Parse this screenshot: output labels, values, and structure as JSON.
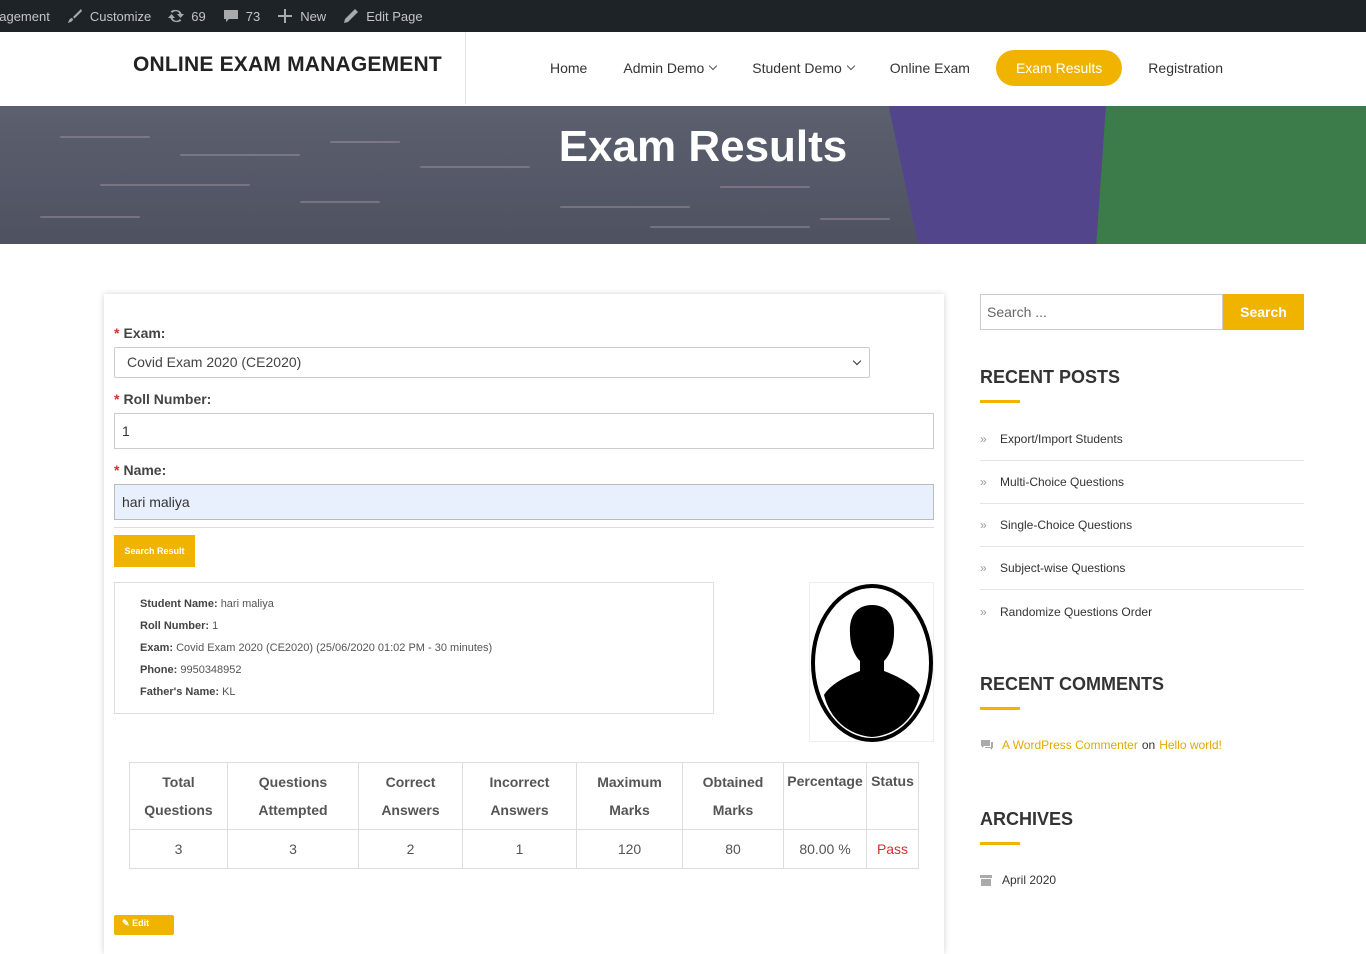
{
  "admin_bar": {
    "site_name": "nagement",
    "customize": "Customize",
    "updates_count": "69",
    "comments_count": "73",
    "new": "New",
    "edit_page": "Edit Page"
  },
  "header": {
    "site_title": "ONLINE EXAM MANAGEMENT",
    "nav": [
      {
        "label": "Home"
      },
      {
        "label": "Admin Demo"
      },
      {
        "label": "Student Demo"
      },
      {
        "label": "Online Exam"
      },
      {
        "label": "Exam Results"
      },
      {
        "label": "Registration"
      }
    ]
  },
  "banner": {
    "title": "Exam Results"
  },
  "form": {
    "exam_label": "Exam:",
    "exam_value": "Covid Exam 2020 (CE2020)",
    "roll_label": "Roll Number:",
    "roll_value": "1",
    "name_label": "Name:",
    "name_value": "hari maliya",
    "required_mark": "*",
    "search_button": "Search Result"
  },
  "student_info": {
    "student_name_label": "Student Name:",
    "student_name": "hari maliya",
    "roll_label": "Roll Number:",
    "roll": "1",
    "exam_label": "Exam:",
    "exam": "Covid Exam 2020 (CE2020) (25/06/2020 01:02 PM - 30 minutes)",
    "phone_label": "Phone:",
    "phone": "9950348952",
    "father_label": "Father's Name:",
    "father": "KL"
  },
  "results_table": {
    "headers": [
      [
        "Total",
        "Questions"
      ],
      [
        "Questions",
        "Attempted"
      ],
      [
        "Correct",
        "Answers"
      ],
      [
        "Incorrect",
        "Answers"
      ],
      [
        "Maximum",
        "Marks"
      ],
      [
        "Obtained",
        "Marks"
      ],
      [
        "Percentage",
        ""
      ],
      [
        "Status",
        ""
      ]
    ],
    "row": [
      "3",
      "3",
      "2",
      "1",
      "120",
      "80",
      "80.00 %",
      "Pass"
    ]
  },
  "edit_button": "Edit",
  "sidebar": {
    "search_placeholder": "Search ...",
    "search_button": "Search",
    "recent_posts_title": "RECENT POSTS",
    "recent_posts": [
      "Export/Import Students",
      "Multi-Choice Questions",
      "Single-Choice Questions",
      "Subject-wise Questions",
      "Randomize Questions Order"
    ],
    "recent_comments_title": "RECENT COMMENTS",
    "comment_author": "A WordPress Commenter",
    "comment_on": "on",
    "comment_post": "Hello world!",
    "archives_title": "ARCHIVES",
    "archive_item": "April 2020"
  },
  "colors": {
    "accent": "#f0b400",
    "admin_bar": "#1d2327",
    "fail_pass_text": "#d0312d"
  }
}
